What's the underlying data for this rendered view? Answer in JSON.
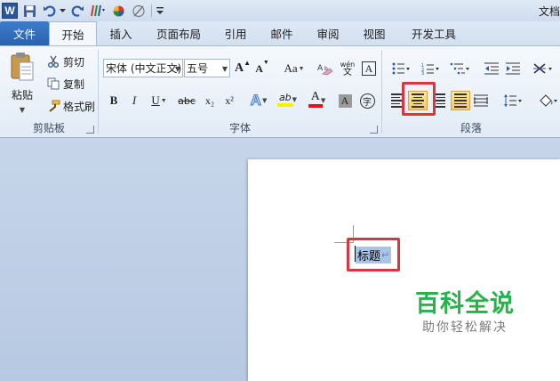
{
  "titlebar": {
    "app_icon": "word-logo-icon",
    "app_letter": "W",
    "title_fragment": "文档",
    "quick_access": [
      "save-icon",
      "undo-icon",
      "redo-icon",
      "format-painter-icon",
      "color-wheel-icon",
      "pen-icon",
      "customize-icon"
    ]
  },
  "tabs": [
    "文件",
    "开始",
    "插入",
    "页面布局",
    "引用",
    "邮件",
    "审阅",
    "视图",
    "开发工具"
  ],
  "active_tab": "开始",
  "clipboard": {
    "group_label": "剪贴板",
    "paste_label": "粘贴",
    "cut_label": "剪切",
    "copy_label": "复制",
    "format_painter_label": "格式刷"
  },
  "font": {
    "group_label": "字体",
    "font_name": "宋体 (中文正文)",
    "font_size": "五号",
    "grow_label": "A",
    "shrink_label": "A",
    "change_case_label": "Aa",
    "bold": "B",
    "italic": "I",
    "underline": "U",
    "strikethrough": "abc",
    "subscript": "x₂",
    "superscript": "x²",
    "text_effect": "A",
    "highlight": "ab",
    "font_color": "A",
    "char_shading": "A",
    "enclose_char": "字",
    "pinyin_label": "wén",
    "font_color_hex": "#e0141e",
    "highlight_hex": "#ffee00"
  },
  "paragraph": {
    "group_label": "段落",
    "active_button": "center-align-button",
    "highlight_hex": "#f8cb5a",
    "red_box_hex": "#d9363e"
  },
  "document": {
    "selected_text": "标题",
    "paragraph_mark": "↵",
    "selection_hex": "#a8c4e8"
  },
  "watermark": {
    "main": "百科全说",
    "sub": "助你轻松解决",
    "main_hex": "#29b14b"
  }
}
